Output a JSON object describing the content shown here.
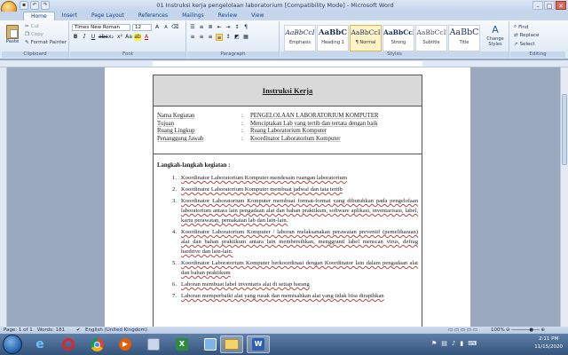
{
  "window": {
    "title": "01 Instruksi kerja pengelolaan laboratorium [Compatibility Mode] - Microsoft Word",
    "controls": [
      "–",
      "□",
      "✕"
    ]
  },
  "ribbon_tabs": [
    "Home",
    "Insert",
    "Page Layout",
    "References",
    "Mailings",
    "Review",
    "View"
  ],
  "clipboard": {
    "paste": "Paste",
    "cut": "Cut",
    "copy": "Copy",
    "format_painter": "Format Painter",
    "label": "Clipboard"
  },
  "font": {
    "name": "Times New Roman",
    "size": "12",
    "label": "Font"
  },
  "paragraph": {
    "label": "Paragraph"
  },
  "styles": {
    "label": "Styles",
    "items": [
      {
        "preview": "AaBbCcI",
        "name": "Emphasis"
      },
      {
        "preview": "AaBbC",
        "name": "Heading 1"
      },
      {
        "preview": "AaBbCcI",
        "name": "¶ Normal"
      },
      {
        "preview": "AaBbCcI",
        "name": "Strong"
      },
      {
        "preview": "AaBbCcI",
        "name": "Subtitle"
      },
      {
        "preview": "AaBbC",
        "name": "Title"
      }
    ],
    "change_styles": "Change Styles"
  },
  "editing": {
    "find": "Find",
    "replace": "Replace",
    "select": "Select",
    "label": "Editing"
  },
  "document": {
    "heading": "Instruksi Kerja",
    "meta": [
      {
        "key": "Nama Kegiatan",
        "value": "PENGELOLAAN LABORATORIUM KOMPUTER"
      },
      {
        "key": "Tujuan",
        "value": "Menciptakan Lab yang tertib dan tertata dengan baik"
      },
      {
        "key": "Ruang Lingkup",
        "value": "Ruang Laboratorium Komputer"
      },
      {
        "key": "Penanggung Jawab",
        "value": "Koordinator Laboratorium Komputer"
      }
    ],
    "steps_title": "Langkah-langkah kegiatan :",
    "steps": [
      {
        "n": "1.",
        "text": "Koordinator Laboratorium Komputer mendesain ruangan laboratorium"
      },
      {
        "n": "2.",
        "text": "Koordinator Laboratorium Komputer membuat jadwal dan tata tertib"
      },
      {
        "n": "3.",
        "text": "Koordinator Laboratorium Komputer membuat format-format yang dibutuhkan pada pengelolaan laboratorium antara lain pengadaan alat dan bahan praktikum, software aplikasi, inventarisasi, label, kartu perawatan, pemakaian lab dan lain-lain."
      },
      {
        "n": "4.",
        "text": "Koordinator Laboratorium Komputer / laboran melaksanakan perawatan preventif (pemeliharaan) alat dan bahan praktikum antara lain membersihkan, menggranti label menscan virus, defrag hardrive dan lain-lain."
      },
      {
        "n": "5.",
        "text": "Koordinator Laboratorium Komputer berkoordinasi dengan Koordinator lain dalam pengadaan alat dan bahan praktikum"
      },
      {
        "n": "6.",
        "text": "Laboran membuat label inventaris alat di setiap barang"
      },
      {
        "n": "7.",
        "text": "Laboran memperbaiki alat yang rusak dan memisahkan alat yang tidak bisa dirapihkan"
      }
    ]
  },
  "status": {
    "page": "Page: 1 of 1",
    "words": "Words: 181",
    "language": "English (United Kingdom)",
    "zoom": "100%"
  },
  "tray": {
    "time": "2:11 PM",
    "date": "11/15/2020"
  }
}
